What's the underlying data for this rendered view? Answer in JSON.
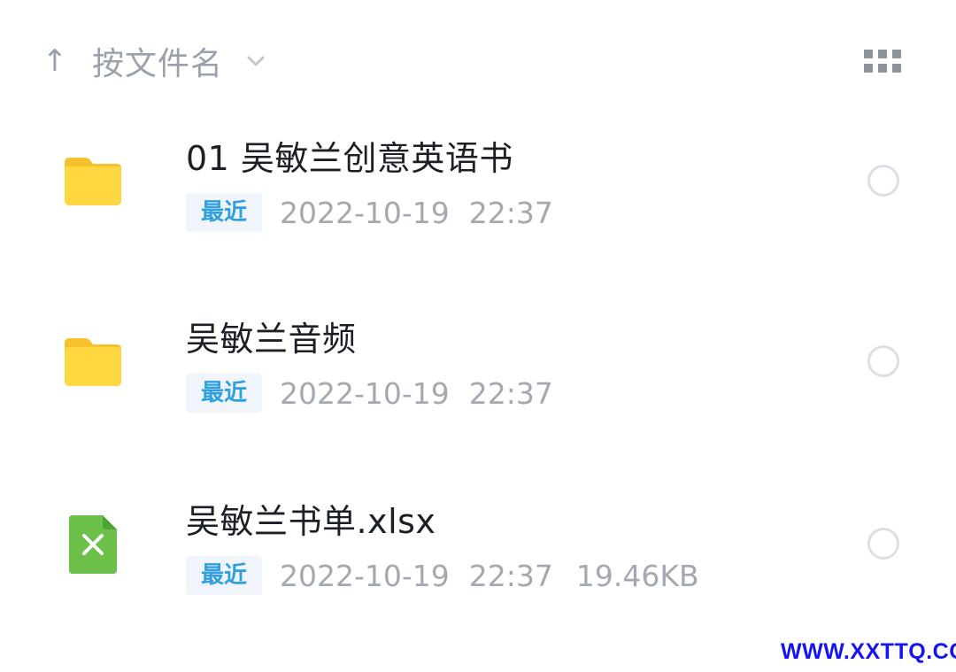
{
  "sort_bar": {
    "arrow": "↑",
    "label": "按文件名",
    "chevron_icon": "chevron-down-icon",
    "view_toggle_icon": "grid-view-icon"
  },
  "files": [
    {
      "name": "01 吴敏兰创意英语书",
      "type": "folder",
      "icon": "folder-icon",
      "badge": "最近",
      "date": "2022-10-19",
      "time": "22:37",
      "size": ""
    },
    {
      "name": "吴敏兰音频",
      "type": "folder",
      "icon": "folder-icon",
      "badge": "最近",
      "date": "2022-10-19",
      "time": "22:37",
      "size": ""
    },
    {
      "name": "吴敏兰书单.xlsx",
      "type": "spreadsheet",
      "icon": "excel-file-icon",
      "badge": "最近",
      "date": "2022-10-19",
      "time": "22:37",
      "size": "19.46KB"
    }
  ],
  "watermark": "WWW.XXTTQ.COM",
  "colors": {
    "folder": "#ffd740",
    "folder_tab": "#f6c12e",
    "excel": "#6cc04a",
    "badge_text": "#2f9fe0",
    "badge_bg": "#f0f5fb",
    "meta_text": "#a4a9b1",
    "watermark": "#1414f0"
  }
}
